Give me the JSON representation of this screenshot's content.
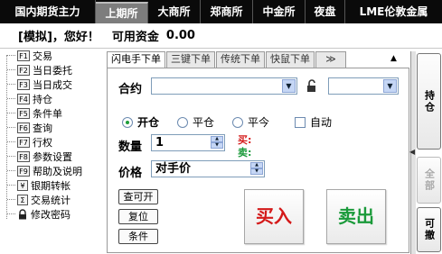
{
  "market_tabs": [
    {
      "label": "国内期货主力",
      "active": false
    },
    {
      "label": "上期所",
      "active": true
    },
    {
      "label": "大商所",
      "active": false
    },
    {
      "label": "郑商所",
      "active": false
    },
    {
      "label": "中金所",
      "active": false
    },
    {
      "label": "夜盘",
      "active": false
    },
    {
      "label": "LME伦敦金属",
      "active": false
    }
  ],
  "status": {
    "mode": "[模拟]，您好！",
    "funds_label": "可用资金",
    "funds_value": "0.00"
  },
  "menu": [
    {
      "key": "F1",
      "label": "交易"
    },
    {
      "key": "F2",
      "label": "当日委托"
    },
    {
      "key": "F3",
      "label": "当日成交"
    },
    {
      "key": "F4",
      "label": "持仓"
    },
    {
      "key": "F5",
      "label": "条件单"
    },
    {
      "key": "F6",
      "label": "查询"
    },
    {
      "key": "F7",
      "label": "行权"
    },
    {
      "key": "F8",
      "label": "参数设置"
    },
    {
      "key": "F9",
      "label": "帮助及说明"
    },
    {
      "key": "¥",
      "label": "银期转帐"
    },
    {
      "key": "Σ",
      "label": "交易统计"
    },
    {
      "key": "lock",
      "label": "修改密码"
    }
  ],
  "order_tabs": [
    "闪电手下单",
    "三键下单",
    "传统下单",
    "快鼠下单",
    "≫"
  ],
  "form": {
    "contract_label": "合约",
    "contract_value": "",
    "account_value": "",
    "open_label": "开仓",
    "close_label": "平仓",
    "close_today_label": "平今",
    "auto_label": "自动",
    "quantity_label": "数量",
    "quantity_value": "1",
    "buy_short": "买:",
    "sell_short": "卖:",
    "price_label": "价格",
    "price_value": "对手价",
    "query_open_button": "查可开",
    "reset_button": "复位",
    "condition_button": "条件",
    "buy_button": "买入",
    "sell_button": "卖出"
  },
  "side_buttons": {
    "position": "持仓",
    "all": "全部",
    "cancel": "可撤"
  },
  "colors": {
    "market_bar": "#0a0a0a",
    "market_active": "#7d7d7d",
    "buy": "#d41a1a",
    "sell": "#1a9a3a"
  }
}
